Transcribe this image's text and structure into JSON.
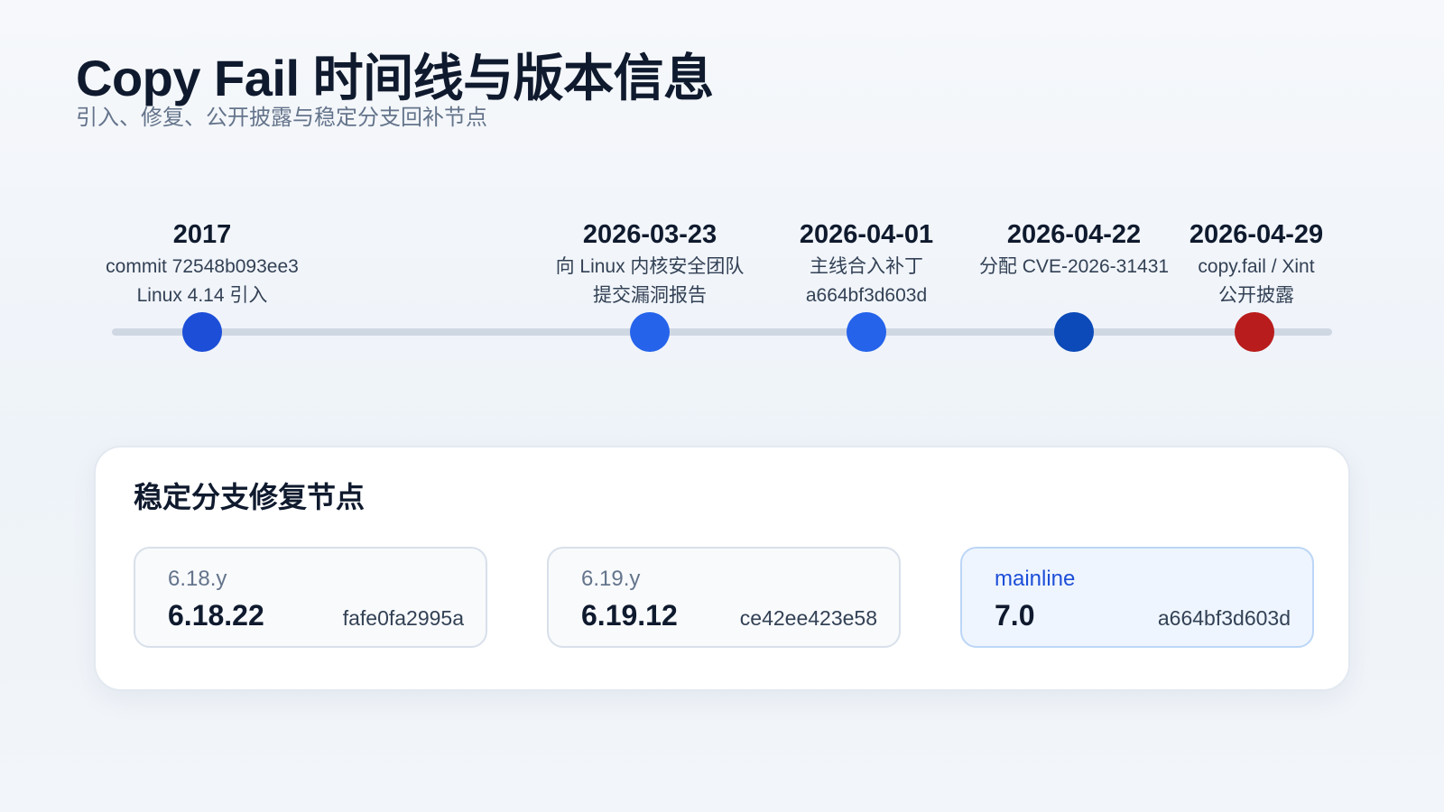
{
  "header": {
    "title": "Copy Fail 时间线与版本信息",
    "subtitle": "引入、修复、公开披露与稳定分支回补节点"
  },
  "timeline": {
    "events": [
      {
        "date": "2017",
        "lines": [
          "commit 72548b093ee3",
          "Linux 4.14 引入"
        ],
        "color": "#1d4ed8"
      },
      {
        "date": "2026-03-23",
        "lines": [
          "向 Linux 内核安全团队",
          "提交漏洞报告"
        ],
        "color": "#2563eb"
      },
      {
        "date": "2026-04-01",
        "lines": [
          "主线合入补丁",
          "a664bf3d603d"
        ],
        "color": "#2563eb"
      },
      {
        "date": "2026-04-22",
        "lines": [
          "分配 CVE-2026-31431"
        ],
        "color": "#0b4ab8"
      },
      {
        "date": "2026-04-29",
        "lines": [
          "copy.fail / Xint",
          "公开披露"
        ],
        "color": "#b91c1c"
      }
    ]
  },
  "stable": {
    "title": "稳定分支修复节点",
    "branches": [
      {
        "name": "6.18.y",
        "version": "6.18.22",
        "commit": "fafe0fa2995a"
      },
      {
        "name": "6.19.y",
        "version": "6.19.12",
        "commit": "ce42ee423e58"
      },
      {
        "name": "mainline",
        "version": "7.0",
        "commit": "a664bf3d603d"
      }
    ]
  }
}
